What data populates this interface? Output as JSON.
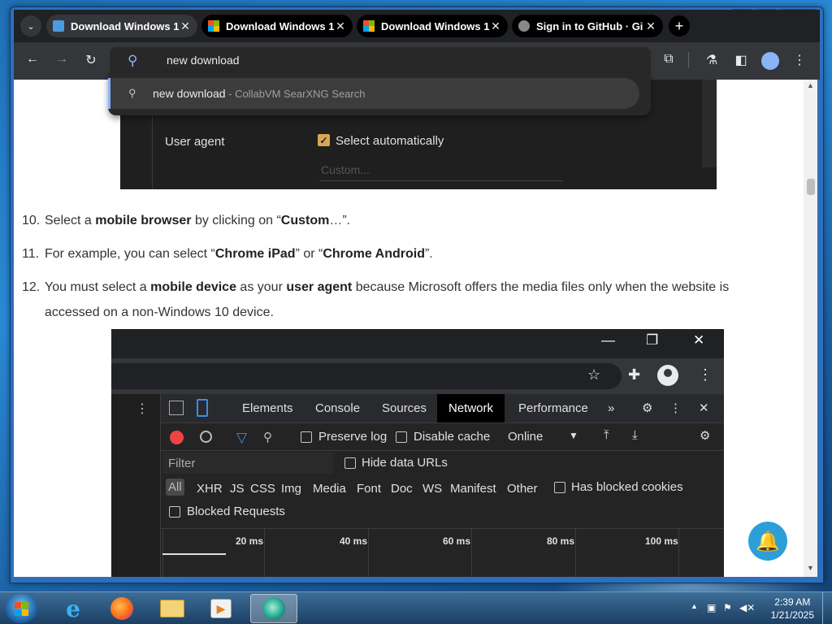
{
  "window": {
    "controls": [
      "minimize-icon",
      "maximize-icon",
      "close-icon"
    ],
    "minimize": "▁",
    "maximize": "□",
    "close": "✕"
  },
  "tabs": [
    {
      "title": "Download Windows 1",
      "favicon": "site-icon",
      "active": true
    },
    {
      "title": "Download Windows 1",
      "favicon": "microsoft-logo-icon",
      "active": false
    },
    {
      "title": "Download Windows 1",
      "favicon": "microsoft-logo-icon",
      "active": false
    },
    {
      "title": "Sign in to GitHub · Gi",
      "favicon": "github-icon",
      "active": false
    }
  ],
  "tab_close": "✕",
  "new_tab": "+",
  "tab_search": "⌄",
  "toolbar": {
    "back": "←",
    "forward": "→",
    "reload": "↻",
    "omnibox_value": "new download",
    "extensions": "⧉",
    "labs": "⚗",
    "sidebar": "◧",
    "menu": "⋮"
  },
  "suggestion": {
    "query": "new download",
    "source": " - CollabVM SearXNG Search"
  },
  "screenshot1": {
    "user_agent_label": "User agent",
    "select_auto": "Select automatically",
    "checkmark": "✓",
    "custom_placeholder": "Custom..."
  },
  "steps": [
    {
      "num": "10.",
      "parts": [
        "Select a ",
        "mobile browser",
        " by clicking on “",
        "Custom",
        "…”."
      ]
    },
    {
      "num": "11.",
      "parts": [
        "For example, you can select “",
        "Chrome iPad",
        "” or “",
        "Chrome Android",
        "”."
      ]
    },
    {
      "num": "12.",
      "parts": [
        "You must select a ",
        "mobile device",
        " as your ",
        "user agent",
        " because Microsoft offers the media files only when the website is accessed on a non-Windows 10 device."
      ]
    }
  ],
  "screenshot2": {
    "title_controls": [
      "—",
      "❐",
      "✕"
    ],
    "star": "☆",
    "puzzle": "✚",
    "kebab": "⋮",
    "devtools": {
      "side_dots": "⋮",
      "tabs": [
        "Elements",
        "Console",
        "Sources",
        "Network",
        "Performance"
      ],
      "selected_tab": "Network",
      "more": "»",
      "settings": "⚙",
      "close": "✕",
      "preserve_log": "Preserve log",
      "disable_cache": "Disable cache",
      "throttle": "Online",
      "filter_placeholder": "Filter",
      "hide_data_urls": "Hide data URLs",
      "types": [
        "All",
        "XHR",
        "JS",
        "CSS",
        "Img",
        "Media",
        "Font",
        "Doc",
        "WS",
        "Manifest",
        "Other"
      ],
      "has_blocked_cookies": "Has blocked cookies",
      "blocked_requests": "Blocked Requests",
      "timeline_labels": [
        "20 ms",
        "40 ms",
        "60 ms",
        "80 ms",
        "100 ms"
      ]
    }
  },
  "notification_bell": "🔔",
  "taskbar": {
    "apps": [
      "internet-explorer-icon",
      "firefox-icon",
      "file-explorer-icon",
      "media-player-icon",
      "collabvm-browser-icon"
    ],
    "time": "2:39 AM",
    "date": "1/21/2025",
    "tray_arrow": "▲"
  },
  "colors": {
    "accent": "#8ab4f8",
    "record": "#ee4444",
    "checkbox": "#d8a653",
    "bell": "#2c9fd8"
  }
}
